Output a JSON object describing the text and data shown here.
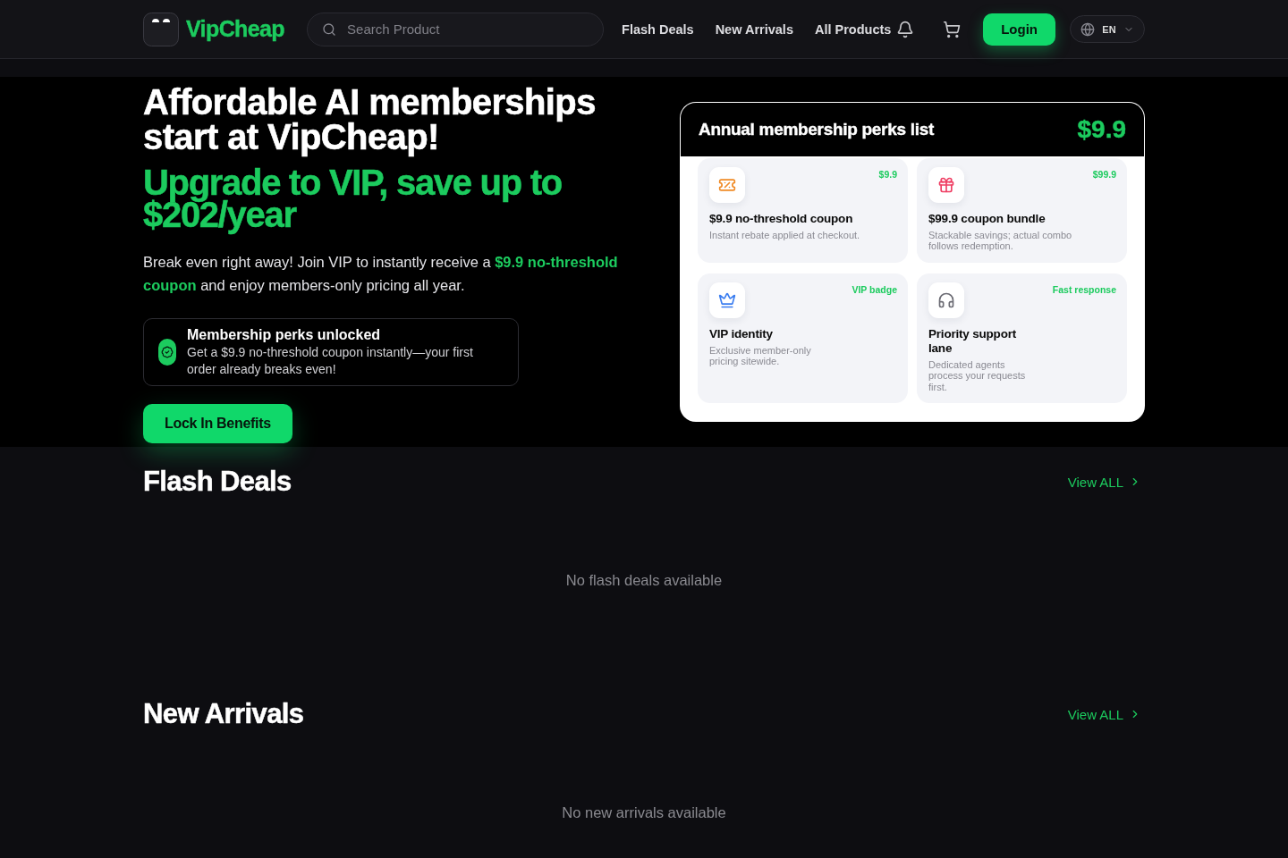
{
  "header": {
    "logo": "VipCheap",
    "search": {
      "placeholder": "Search Product"
    },
    "nav": [
      {
        "label": "Flash Deals"
      },
      {
        "label": "New Arrivals"
      },
      {
        "label": "All Products"
      }
    ],
    "login": "Login",
    "language": "EN"
  },
  "hero": {
    "title": "Affordable AI memberships start at VipCheap!",
    "subtitle": "Upgrade to VIP, save up to $202/year",
    "description": "Break even right away! Join VIP to instantly receive a **$9.9 no-threshold coupon** and enjoy members-only pricing all year.",
    "notice": {
      "title": "Membership perks unlocked",
      "text": "Get a $9.9 no-threshold coupon instantly—your first order already breaks even!"
    },
    "cta": "Lock In Benefits"
  },
  "perks_card": {
    "title": "Annual membership perks list",
    "price": "$9.9",
    "perks": [
      {
        "kind": "coupon",
        "tag": "$9.9",
        "title": "$9.9 no-threshold coupon",
        "description": "Instant rebate applied at checkout."
      },
      {
        "kind": "gift",
        "tag": "$99.9",
        "title": "$99.9 coupon bundle",
        "description": "Stackable savings; actual combo follows redemption."
      },
      {
        "kind": "crown",
        "tag": "VIP badge",
        "title": "VIP identity",
        "description": "Exclusive member-only pricing sitewide."
      },
      {
        "kind": "support",
        "tag": "Fast response",
        "title": "Priority support lane",
        "description": "Dedicated agents process your requests first."
      }
    ]
  },
  "sections": [
    {
      "title": "Flash Deals",
      "link": "View ALL",
      "empty_text": "No flash deals available"
    },
    {
      "title": "New Arrivals",
      "link": "View ALL",
      "empty_text": "No new arrivals available"
    }
  ]
}
